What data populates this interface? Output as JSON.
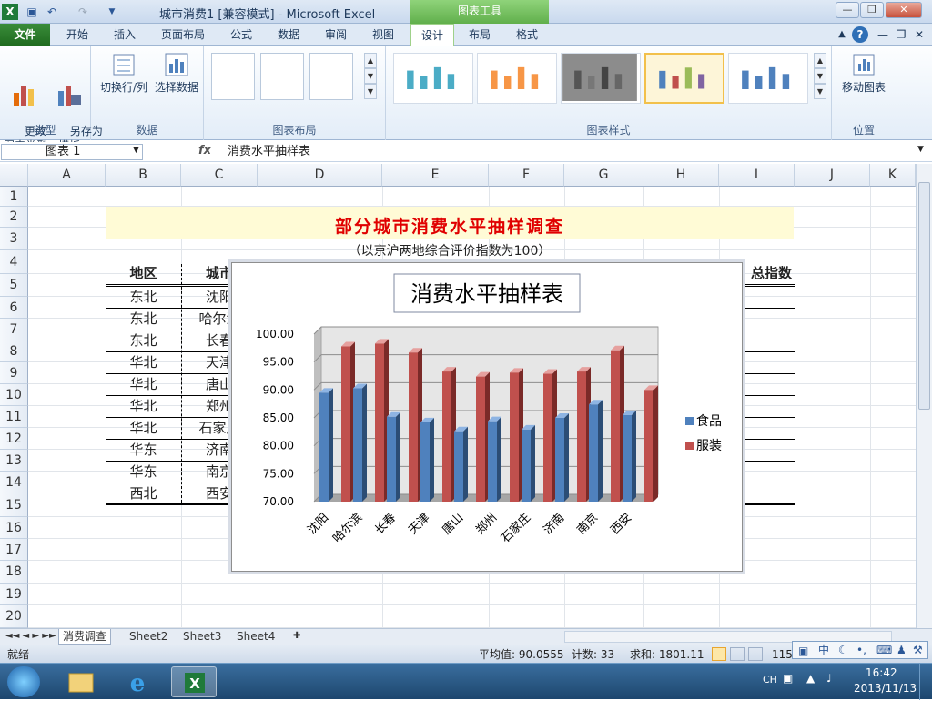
{
  "app": {
    "title": "城市消费1  [兼容模式] - Microsoft Excel",
    "chart_tools": "图表工具"
  },
  "tabs": [
    {
      "label": "文件"
    },
    {
      "label": "开始"
    },
    {
      "label": "插入"
    },
    {
      "label": "页面布局"
    },
    {
      "label": "公式"
    },
    {
      "label": "数据"
    },
    {
      "label": "审阅"
    },
    {
      "label": "视图"
    },
    {
      "label": "设计"
    },
    {
      "label": "布局"
    },
    {
      "label": "格式"
    }
  ],
  "ribbon": {
    "change_type": "更改\n图表类型",
    "save_template": "另存为\n模板",
    "switch_rowcol": "切换行/列",
    "select_data": "选择数据",
    "move_chart": "移动图表",
    "groups": {
      "type": "类型",
      "data": "数据",
      "layout": "图表布局",
      "styles": "图表样式",
      "location": "位置"
    }
  },
  "formula_bar": {
    "name_box": "图表 1",
    "fx": "fx",
    "formula": "消费水平抽样表"
  },
  "columns": [
    "A",
    "B",
    "C",
    "D",
    "E",
    "F",
    "G",
    "H",
    "I",
    "J",
    "K"
  ],
  "rows": [
    "1",
    "2",
    "3",
    "4",
    "5",
    "6",
    "7",
    "8",
    "9",
    "10",
    "11",
    "12",
    "13",
    "14",
    "15",
    "16",
    "17",
    "18",
    "19",
    "20"
  ],
  "sheet": {
    "title": "部分城市消费水平抽样调查",
    "subtitle": "（以京沪两地综合评价指数为100）",
    "header_region": "地区",
    "header_city": "城市",
    "header_index": "总指数",
    "regions": [
      "东北",
      "东北",
      "东北",
      "华北",
      "华北",
      "华北",
      "华北",
      "华东",
      "华东",
      "西北"
    ],
    "cities_visible": [
      "沈阳",
      "哈尔滨",
      "长春",
      "天津",
      "唐山",
      "郑州",
      "石家庄",
      "济南",
      "南京",
      "西安"
    ]
  },
  "chart_data": {
    "type": "bar",
    "title": "消费水平抽样表",
    "categories": [
      "沈阳",
      "哈尔滨",
      "长春",
      "天津",
      "唐山",
      "郑州",
      "石家庄",
      "济南",
      "南京",
      "西安"
    ],
    "series": [
      {
        "name": "食品",
        "color": "#4f81bd",
        "values": [
          89.5,
          90.3,
          85.2,
          84.2,
          82.6,
          84.4,
          82.9,
          85.0,
          87.4,
          85.5
        ]
      },
      {
        "name": "服装",
        "color": "#c0504d",
        "values": [
          97.8,
          98.3,
          96.7,
          93.3,
          92.4,
          93.1,
          92.9,
          93.3,
          97.1,
          90.0
        ]
      }
    ],
    "ylim": [
      70,
      100
    ],
    "yticks": [
      "70.00",
      "75.00",
      "80.00",
      "85.00",
      "90.00",
      "95.00",
      "100.00"
    ],
    "legend": "right",
    "grid": true
  },
  "sheet_tabs": [
    "消费调查",
    "Sheet2",
    "Sheet3",
    "Sheet4"
  ],
  "status": {
    "ready": "就绪",
    "average": "平均值: 90.0555",
    "count": "计数: 33",
    "sum": "求和: 1801.11",
    "zoom": "115"
  },
  "ime": {
    "lang": "中"
  },
  "taskbar": {
    "lang": "CH",
    "time": "16:42",
    "date": "2013/11/13"
  }
}
